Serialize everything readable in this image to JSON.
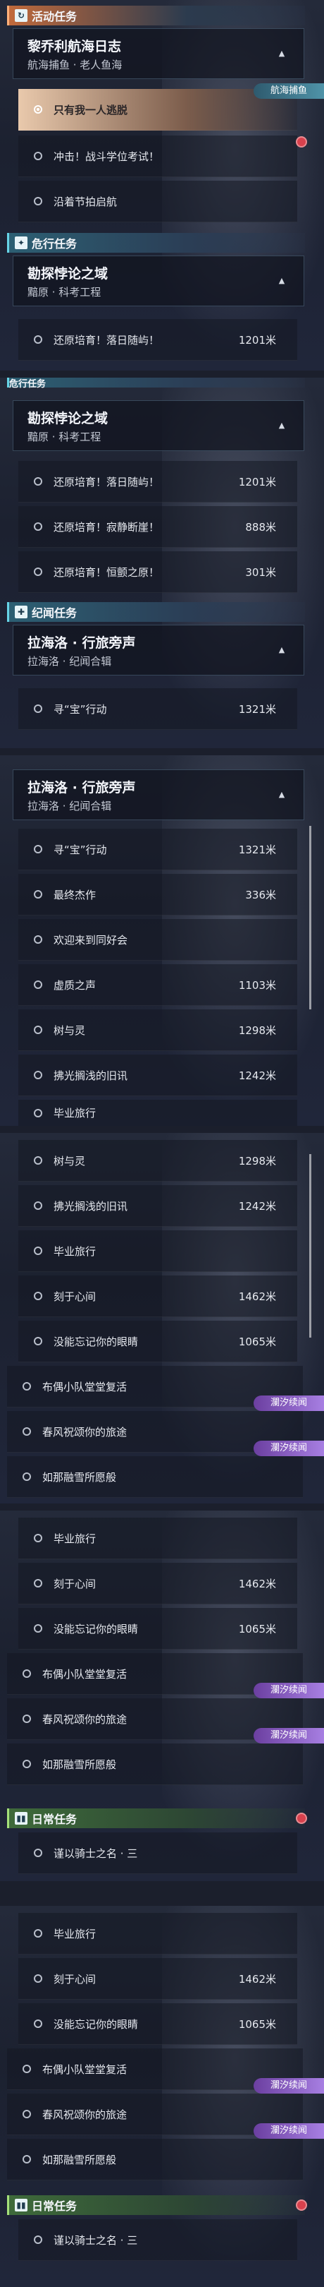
{
  "sections": {
    "activity": "活动任务",
    "danger": "危行任务",
    "danger_cut": "危行任务",
    "chronicle": "纪闻任务",
    "daily": "日常任务"
  },
  "quests": {
    "lichor": {
      "title": "黎乔利航海日志",
      "sub": "航海捕鱼 · 老人鱼海"
    },
    "explore": {
      "title": "勘探悖论之域",
      "sub": "黯原 · 科考工程"
    },
    "lahai": {
      "title": "拉海洛 · 行旅旁声",
      "sub": "拉海洛 · 纪闻合辑"
    }
  },
  "items": {
    "i1": "只有我一人逃脱",
    "i2": "冲击！战斗学位考试！",
    "i3": "沿着节拍启航",
    "r1": "还原培育！落日随屿！",
    "r2": "还原培育！寂静断崖！",
    "r3": "还原培育！恒颤之原！",
    "x1": "寻“宝”行动",
    "x2": "最终杰作",
    "x3": "欢迎来到同好会",
    "x4": "虚质之声",
    "x5": "树与灵",
    "x6": "拂光搁浅的旧讯",
    "x7": "毕业旅行",
    "x8": "刻于心间",
    "x9": "没能忘记你的眼睛",
    "x10": "布偶小队堂堂复活",
    "x11": "春风祝颂你的旅途",
    "x12": "如那融雪所愿般",
    "d1": "谨以骑士之名 · 三"
  },
  "distances": {
    "d1201": "1201米",
    "d888": "888米",
    "d301": "301米",
    "d1321": "1321米",
    "d336": "336米",
    "d1103": "1103米",
    "d1298": "1298米",
    "d1242": "1242米",
    "d1462": "1462米",
    "d1065": "1065米"
  },
  "tags": {
    "fishing": "航海捕鱼",
    "lanxi": "瀾汐续闻"
  },
  "icons": {
    "activity": "↻",
    "danger": "✦",
    "chronicle": "✚",
    "daily": "▮▮",
    "chev": "▲"
  },
  "colors": {
    "accent": "#67d4e6",
    "selected": "#e9c9ac",
    "tag_purple": "#a77fe2",
    "alert": "#d8414d"
  }
}
